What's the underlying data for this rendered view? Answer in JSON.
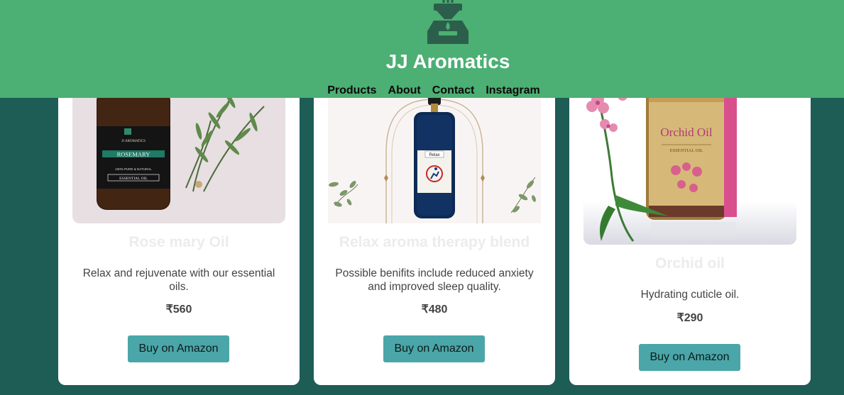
{
  "brand": {
    "name": "JJ Aromatics",
    "logo_icon": "aroma-diffuser-icon"
  },
  "nav": [
    {
      "label": "Products"
    },
    {
      "label": "About"
    },
    {
      "label": "Contact"
    },
    {
      "label": "Instagram"
    }
  ],
  "products": [
    {
      "title": "Rose mary Oil",
      "desc": "Relax and rejuvenate with our essential oils.",
      "price": "₹560",
      "button": "Buy on Amazon",
      "label_brand": "JJ AROMATICS",
      "label_name": "ROSEMARY",
      "label_sub": "ESSENTIAL OIL",
      "label_pure": "100% PURE & NATURAL"
    },
    {
      "title": "Relax aroma therapy blend",
      "desc": "Possible benifits include reduced anxiety and improved sleep quality.",
      "price": "₹480",
      "button": "Buy on Amazon",
      "label_name": "Relax"
    },
    {
      "title": "Orchid oil",
      "desc": "Hydrating cuticle oil.",
      "price": "₹290",
      "button": "Buy on Amazon",
      "label_name": "Orchid Oil",
      "label_sub": "ESSENTIAL OIL"
    }
  ],
  "colors": {
    "header": "#4caf73",
    "background": "#1e5c56",
    "button": "#4aa6a8",
    "card": "#ffffff"
  }
}
